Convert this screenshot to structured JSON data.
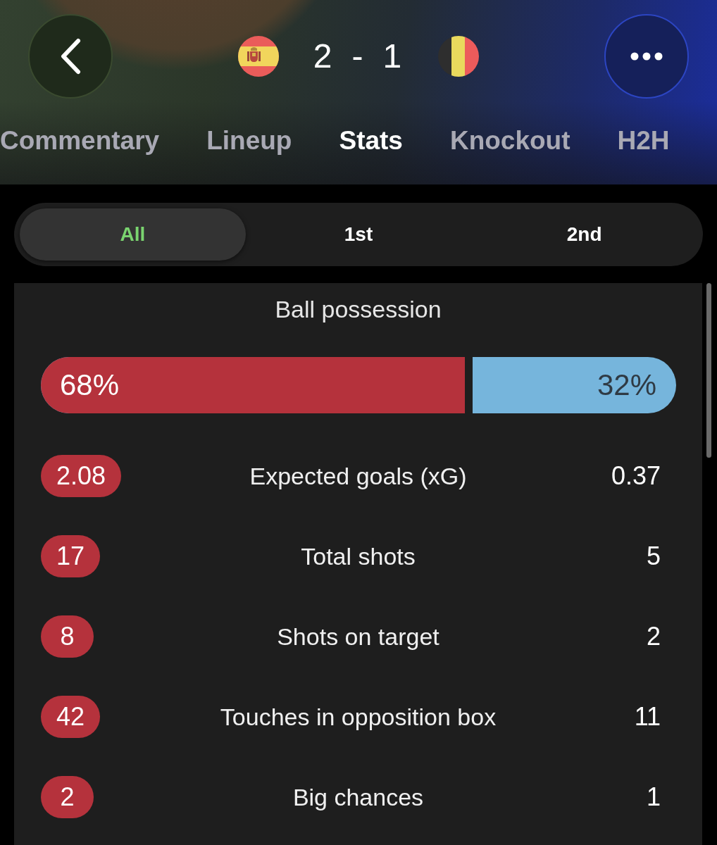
{
  "match": {
    "home_score": "2",
    "separator": "-",
    "away_score": "1"
  },
  "tabs": [
    {
      "label": "Commentary",
      "selected": false
    },
    {
      "label": "Lineup",
      "selected": false
    },
    {
      "label": "Stats",
      "selected": true
    },
    {
      "label": "Knockout",
      "selected": false
    },
    {
      "label": "H2H",
      "selected": false
    }
  ],
  "periods": [
    {
      "label": "All",
      "selected": true
    },
    {
      "label": "1st",
      "selected": false
    },
    {
      "label": "2nd",
      "selected": false
    }
  ],
  "possession": {
    "title": "Ball possession",
    "home": "68%",
    "away": "32%",
    "level": 0.68
  },
  "stats": [
    {
      "label": "Expected goals (xG)",
      "home": "2.08",
      "away": "0.37",
      "home_highlighted": true,
      "away_highlighted": false
    },
    {
      "label": "Total shots",
      "home": "17",
      "away": "5",
      "home_highlighted": true,
      "away_highlighted": false
    },
    {
      "label": "Shots on target",
      "home": "8",
      "away": "2",
      "home_highlighted": true,
      "away_highlighted": false
    },
    {
      "label": "Touches in opposition box",
      "home": "42",
      "away": "11",
      "home_highlighted": true,
      "away_highlighted": false
    },
    {
      "label": "Big chances",
      "home": "2",
      "away": "1",
      "home_highlighted": true,
      "away_highlighted": false
    }
  ]
}
